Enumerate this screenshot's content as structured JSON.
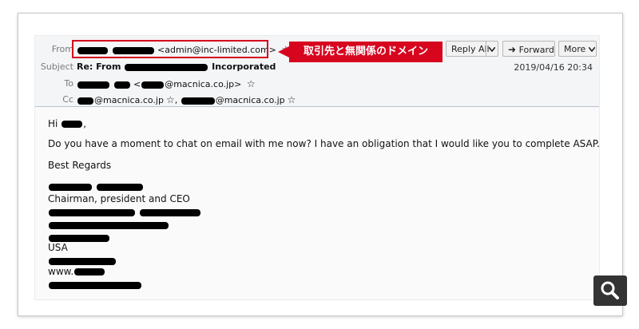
{
  "header": {
    "from_label": "From",
    "from_email": "<admin@inc-limited.com>",
    "subject_label": "Subject",
    "subject_prefix": "Re: From",
    "subject_suffix": "Incorporated",
    "to_label": "To",
    "to_email": "@macnica.co.jp>",
    "cc_label": "Cc",
    "cc_email_1": "@macnica.co.jp",
    "cc_email_2": "@macnica.co.jp",
    "date": "2019/04/16 20:34",
    "star_icon": "☆"
  },
  "toolbar": {
    "reply_all_label": "Reply All",
    "forward_label": "Forward",
    "more_label": "More"
  },
  "callout": {
    "text": "取引先と無関係のドメイン",
    "color": "#d7051e"
  },
  "body": {
    "greeting": "Hi",
    "line1": "Do you have a moment to chat on email with me now? I have an obligation that I would like you to complete ASAP.",
    "closing": "Best Regards",
    "title": "Chairman, president and CEO",
    "country": "USA",
    "web_prefix": "www."
  }
}
